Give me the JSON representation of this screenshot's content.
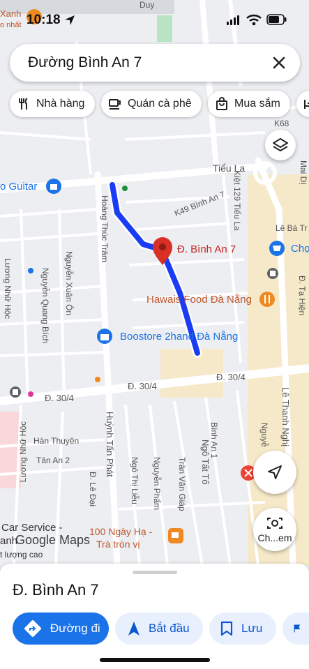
{
  "status": {
    "time": "10:18"
  },
  "search": {
    "query": "Đường Bình An 7"
  },
  "chips": [
    {
      "label": "Nhà hàng",
      "icon": "fork-knife-icon"
    },
    {
      "label": "Quán cà phê",
      "icon": "coffee-cup-icon"
    },
    {
      "label": "Mua sắm",
      "icon": "shopping-bag-icon"
    }
  ],
  "map": {
    "labels": {
      "xanh": "Xanh",
      "nhat": "o nhất",
      "duy": "Duy",
      "k68": "K68",
      "mai_di": "Mai Dị",
      "tieu_la": "Tiểu La",
      "guitar": "o Guitar",
      "k49": "K49 Bình An 7",
      "kiet129": "Kiệt 129 Tiểu La",
      "le_ba_trinh": "Lê Bá Tr",
      "cho": "Chợ",
      "hoang_thuc_tram": "Hoàng Thúc Trâm",
      "binh_an_7_pin": "Đ. Bình An 7",
      "hawais": "Hawais Food Đà Nẵng",
      "ta_hien": "Đ. Tạ Hiện",
      "luong_nhu_hoc": "Lương Nhữ Hộc",
      "nguyen_quang_bich": "Nguyễn Quang Bích",
      "nguyen_xuan_on": "Nguyễn Xuân Ôn",
      "boostore": "Boostore 2hand Đà Nẵng",
      "d304_a": "Đ. 30/4",
      "d304_b": "Đ. 30/4",
      "d304_c": "Đ. 30/4",
      "le_thanh_nghi": "Lê Thanh Nghị",
      "nguyen_short": "Nguyễ",
      "han_thuyen": "Hàn Thuyên",
      "tan_an_2": "Tân An 2",
      "luong_nhu_hoc_2": "Lương Nhữ Hộc",
      "huynh_tan_phat": "Huỳnh Tấn Phát",
      "binh_an_1": "Bình An 1",
      "le_dai": "Đ. Lê Đại",
      "ngo_thi_lieu": "Ngô Thị Liễu",
      "nguyen_pham": "Nguyễn Phẩm",
      "tran_van_giap": "Trần Văn Giáp",
      "ngo_tat_to": "Ngô Tất Tố",
      "car_service": "Car Service -",
      "anh": "anh",
      "google_maps": "Google Maps",
      "ngay_ha": "100 Ngày Hạ -",
      "tra_tron_vi": "Trà tròn vị",
      "luong_cao": "t lượng cao"
    },
    "camera_label": "Ch...em"
  },
  "sheet": {
    "place_name": "Đ. Bình An 7",
    "buttons": [
      {
        "label": "Đường đi",
        "icon": "directions-icon"
      },
      {
        "label": "Bắt đầu",
        "icon": "navigation-arrow-icon"
      },
      {
        "label": "Lưu",
        "icon": "bookmark-icon"
      }
    ]
  },
  "colors": {
    "route": "#1a3cf5",
    "pin": "#d93025",
    "accent_blue": "#1a73e8",
    "poi_orange": "#ef8a23"
  }
}
